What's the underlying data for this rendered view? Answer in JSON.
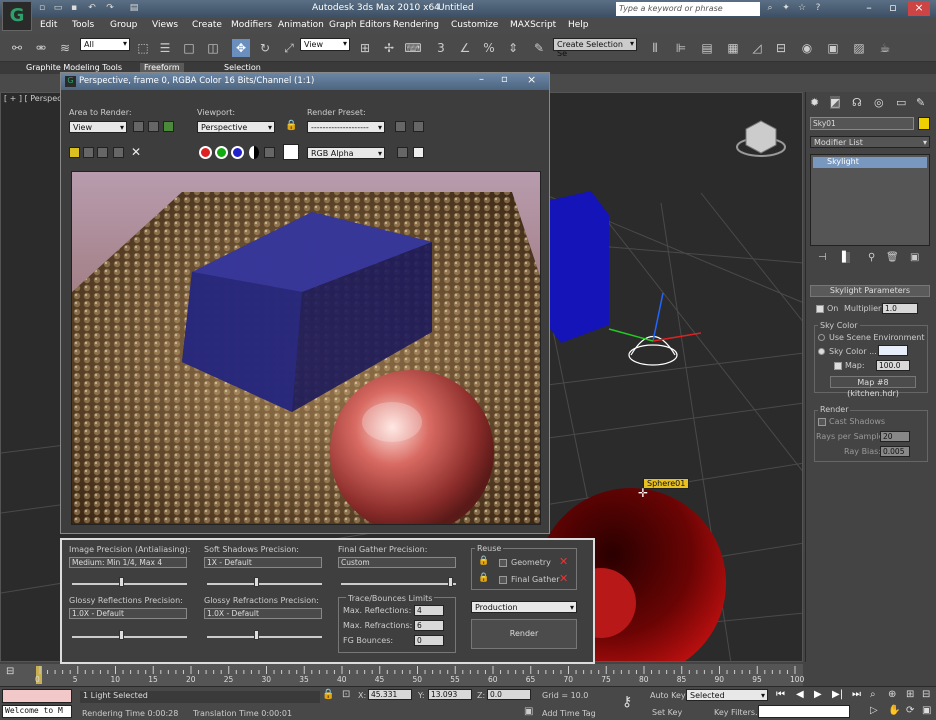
{
  "app": {
    "title": "Autodesk 3ds Max  2010 x64",
    "document": "Untitled",
    "search_placeholder": "Type a keyword or phrase",
    "logo": "G"
  },
  "menu": [
    "Edit",
    "Tools",
    "Group",
    "Views",
    "Create",
    "Modifiers",
    "Animation",
    "Graph Editors",
    "Rendering",
    "Customize",
    "MAXScript",
    "Help"
  ],
  "toolbar": {
    "selection_filter": "All",
    "reference_coord": "View",
    "named_selection": "Create Selection Se"
  },
  "ribbon_tabs": [
    "Graphite Modeling Tools",
    "Freeform",
    "Selection"
  ],
  "viewport": {
    "label": "[ + ] [ Perspective",
    "object_tooltip": "Sphere01"
  },
  "render_window": {
    "title": "Perspective, frame 0, RGBA Color 16 Bits/Channel (1:1)",
    "area_label": "Area to Render:",
    "area_value": "View",
    "viewport_label": "Viewport:",
    "viewport_value": "Perspective",
    "preset_label": "Render Preset:",
    "preset_value": "--------------------",
    "channel_value": "RGB Alpha"
  },
  "render_settings": {
    "image_precision_label": "Image Precision (Antialiasing):",
    "image_precision_value": "Medium: Min 1/4, Max 4",
    "image_precision_level": 0.43,
    "soft_shadows_label": "Soft Shadows Precision:",
    "soft_shadows_value": "1X - Default",
    "soft_shadows_level": 0.43,
    "final_gather_label": "Final Gather Precision:",
    "final_gather_value": "Custom",
    "final_gather_level": 0.97,
    "glossy_refl_label": "Glossy Reflections Precision:",
    "glossy_refl_value": "1.0X - Default",
    "glossy_refl_level": 0.43,
    "glossy_refr_label": "Glossy Refractions Precision:",
    "glossy_refr_value": "1.0X - Default",
    "glossy_refr_level": 0.43,
    "trace_label": "Trace/Bounces Limits",
    "max_reflections_label": "Max. Reflections:",
    "max_reflections": "4",
    "max_refractions_label": "Max. Refractions:",
    "max_refractions": "6",
    "fg_bounces_label": "FG Bounces:",
    "fg_bounces": "0",
    "reuse_label": "Reuse",
    "geometry_label": "Geometry",
    "final_gather_reuse_label": "Final Gather",
    "production_value": "Production",
    "render_button": "Render"
  },
  "command_panel": {
    "object_name": "Sky01",
    "modifier_list": "Modifier List",
    "stack_item": "Skylight",
    "rollout_title": "Skylight Parameters",
    "on_label": "On",
    "multiplier_label": "Multiplier:",
    "multiplier_value": "1.0",
    "sky_color_group": "Sky Color",
    "use_scene_env": "Use Scene Environment",
    "sky_color_label": "Sky Color ...",
    "map_label": "Map:",
    "map_value": "100.0",
    "map_button": "Map #8 (kitchen.hdr)",
    "render_group": "Render",
    "cast_shadows": "Cast Shadows",
    "rays_label": "Rays per Sample:",
    "rays_value": "20",
    "ray_bias_label": "Ray Bias:",
    "ray_bias_value": "0.005"
  },
  "timeline": {
    "frame_counter": "0 / 100",
    "ticks": [
      "0",
      "5",
      "10",
      "15",
      "20",
      "25",
      "30",
      "35",
      "40",
      "45",
      "50",
      "55",
      "60",
      "65",
      "70",
      "75",
      "80",
      "85",
      "90",
      "95",
      "100"
    ]
  },
  "status": {
    "maxscript": "Welcome to M",
    "selected": "1 Light Selected",
    "rendering_time": "Rendering Time  0:00:28",
    "translation_time": "Translation Time  0:00:01",
    "x_label": "X:",
    "x_value": "45.331",
    "y_label": "Y:",
    "y_value": "13.093",
    "z_label": "Z:",
    "z_value": "0.0",
    "grid": "Grid = 10.0",
    "add_time_tag": "Add Time Tag",
    "auto_key": "Auto Key",
    "selected_dropdown": "Selected",
    "set_key": "Set Key",
    "key_filters": "Key Filters..."
  },
  "colors": {
    "title_bar": "#4d6580",
    "viewport_bg": "#2b2b2b",
    "sphere_red": "#b01010",
    "box_blue": "#1a1aa8"
  }
}
